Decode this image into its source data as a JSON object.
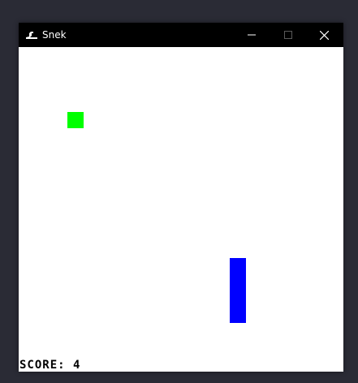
{
  "window": {
    "title": "Snek",
    "icon": "snake-icon",
    "controls": [
      "minimize-icon",
      "maximize-icon",
      "close-icon"
    ]
  },
  "game": {
    "score_label": "SCORE:",
    "score_value": "4",
    "food_color": "#00ff00",
    "snake_color": "#0000ff",
    "snake_length": 4
  }
}
